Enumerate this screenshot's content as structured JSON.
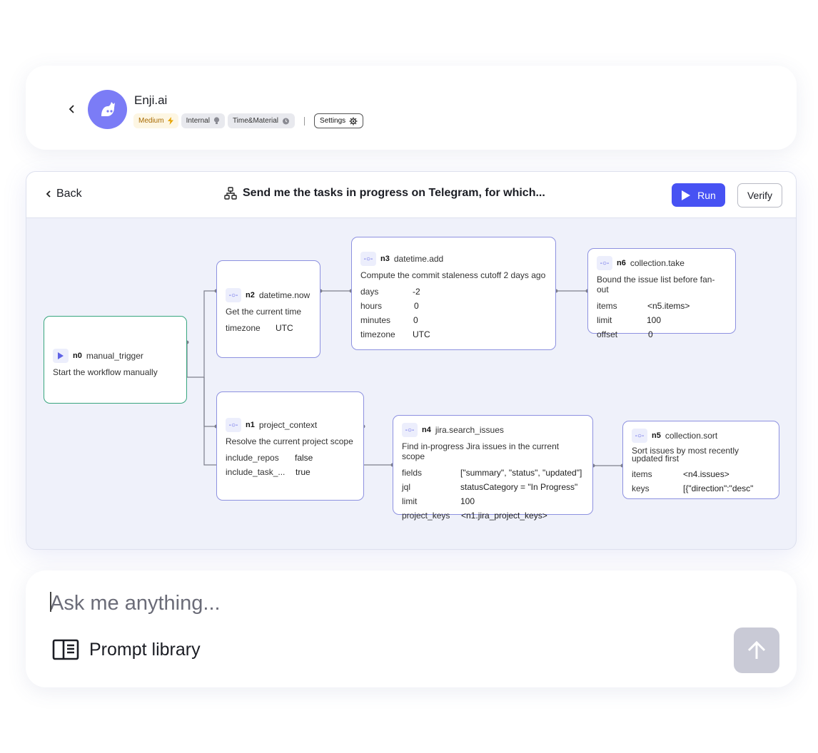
{
  "header": {
    "brand": "Enji.ai",
    "tags": {
      "medium": "Medium",
      "internal": "Internal",
      "time_material": "Time&Material",
      "settings": "Settings"
    }
  },
  "toolbar": {
    "back": "Back",
    "title": "Send me the tasks in progress on Telegram, for which...",
    "run": "Run",
    "verify": "Verify"
  },
  "nodes": {
    "n0": {
      "id": "n0",
      "type": "manual_trigger",
      "desc": "Start the workflow manually"
    },
    "n2": {
      "id": "n2",
      "type": "datetime.now",
      "desc": "Get the current time",
      "params": [
        {
          "k": "timezone",
          "v": "UTC"
        }
      ]
    },
    "n3": {
      "id": "n3",
      "type": "datetime.add",
      "desc": "Compute the commit staleness cutoff 2 days ago",
      "params": [
        {
          "k": "days",
          "v": "-2"
        },
        {
          "k": "hours",
          "v": "0"
        },
        {
          "k": "minutes",
          "v": "0"
        },
        {
          "k": "timezone",
          "v": "UTC"
        }
      ]
    },
    "n6": {
      "id": "n6",
      "type": "collection.take",
      "desc": "Bound the issue list before fan-out",
      "params": [
        {
          "k": "items",
          "v": "<n5.items>"
        },
        {
          "k": "limit",
          "v": "100"
        },
        {
          "k": "offset",
          "v": "0"
        }
      ]
    },
    "n1": {
      "id": "n1",
      "type": "project_context",
      "desc": "Resolve the current project scope",
      "params": [
        {
          "k": "include_repos",
          "v": "false"
        },
        {
          "k": "include_task_...",
          "v": "true"
        }
      ]
    },
    "n4": {
      "id": "n4",
      "type": "jira.search_issues",
      "desc": "Find in-progress Jira issues in the current scope",
      "params": [
        {
          "k": "fields",
          "v": "[\"summary\", \"status\", \"updated\"]"
        },
        {
          "k": "jql",
          "v": "statusCategory = \"In Progress\""
        },
        {
          "k": "limit",
          "v": "100"
        },
        {
          "k": "project_keys",
          "v": "<n1.jira_project_keys>"
        }
      ]
    },
    "n5": {
      "id": "n5",
      "type": "collection.sort",
      "desc": "Sort issues by most recently updated first",
      "params": [
        {
          "k": "items",
          "v": "<n4.issues>"
        },
        {
          "k": "keys",
          "v": "[{\"direction\":\"desc\""
        }
      ]
    }
  },
  "prompt": {
    "placeholder": "Ask me anything...",
    "library": "Prompt library"
  },
  "colors": {
    "accent": "#4752f3",
    "avatar": "#7b7cf6",
    "node_border": "#8d91e0",
    "trigger_border": "#37a57e",
    "canvas": "#eff1fa"
  },
  "icons": {
    "back": "chevron-left-icon",
    "workflow": "workflow-icon",
    "run": "play-icon",
    "library": "book-icon",
    "send": "arrow-up-icon"
  }
}
